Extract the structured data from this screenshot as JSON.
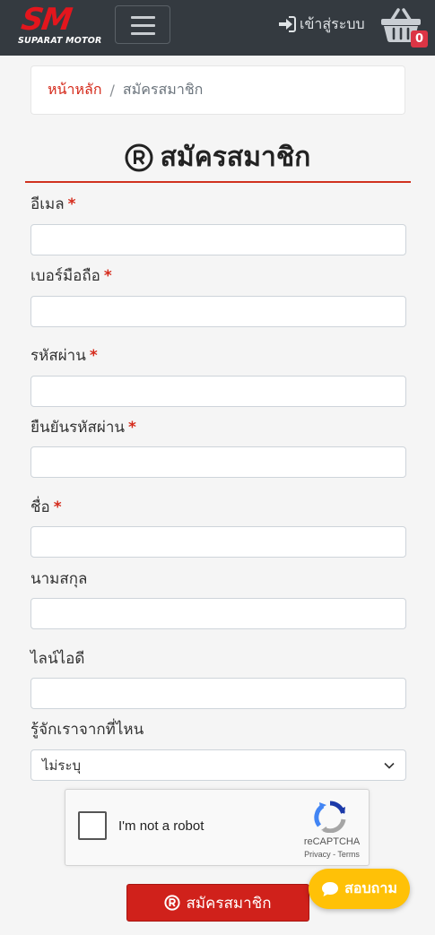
{
  "header": {
    "logo_text": "SM",
    "logo_subtext": "SUPARAT MOTOR",
    "login_label": "เข้าสู่ระบบ",
    "cart_count": "0",
    "icons": {
      "menu": "hamburger-icon",
      "login": "sign-in-icon",
      "cart": "basket-icon"
    }
  },
  "breadcrumb": {
    "home": "หน้าหลัก",
    "separator": "/",
    "current": "สมัครสมาชิก"
  },
  "page": {
    "title": "สมัครสมาชิก",
    "title_icon": "registered-icon"
  },
  "form": {
    "fields": [
      {
        "label": "อีเมล",
        "required": "*",
        "value": ""
      },
      {
        "label": "เบอร์มือถือ",
        "required": "*",
        "value": ""
      },
      {
        "label": "รหัสผ่าน",
        "required": "*",
        "value": ""
      },
      {
        "label": "ยืนยันรหัสผ่าน",
        "required": "*",
        "value": ""
      },
      {
        "label": "ชื่อ",
        "required": "*",
        "value": ""
      },
      {
        "label": "นามสกุล",
        "value": ""
      },
      {
        "label": "ไลน์ไอดี",
        "value": ""
      }
    ],
    "source": {
      "label": "รู้จักเราจากที่ไหน",
      "selected": "ไม่ระบุ"
    },
    "submit_label": "สมัครสมาชิก"
  },
  "recaptcha": {
    "text": "I'm not a robot",
    "brand": "reCAPTCHA",
    "links": "Privacy - Terms"
  },
  "chat": {
    "label": "สอบถาม",
    "icon": "chat-bubble-icon"
  },
  "colors": {
    "navbar": "#343a40",
    "brand_red": "#d0211b",
    "chat_yellow": "#ffc107"
  }
}
